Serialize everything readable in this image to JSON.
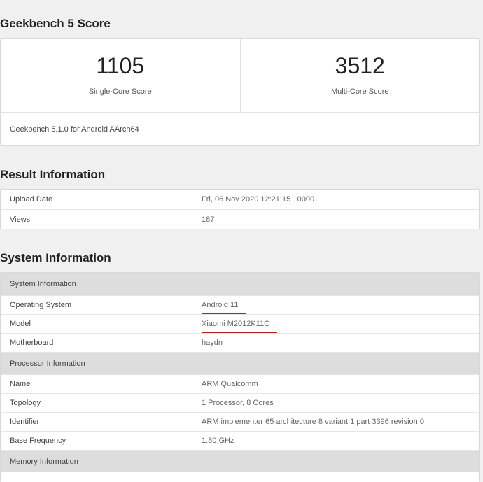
{
  "geekbench": {
    "title": "Geekbench 5 Score",
    "single_core_value": "1105",
    "single_core_label": "Single-Core Score",
    "multi_core_value": "3512",
    "multi_core_label": "Multi-Core Score",
    "version": "Geekbench 5.1.0 for Android AArch64"
  },
  "result": {
    "title": "Result Information",
    "rows": [
      {
        "key": "Upload Date",
        "value": "Fri, 06 Nov 2020 12:21:15 +0000"
      },
      {
        "key": "Views",
        "value": "187"
      }
    ]
  },
  "system": {
    "title": "System Information",
    "system_header": "System Information",
    "system_rows": [
      {
        "key": "Operating System",
        "value": "Android 11"
      },
      {
        "key": "Model",
        "value": "Xiaomi M2012K11C"
      },
      {
        "key": "Motherboard",
        "value": "haydn"
      }
    ],
    "processor_header": "Processor Information",
    "processor_rows": [
      {
        "key": "Name",
        "value": "ARM Qualcomm"
      },
      {
        "key": "Topology",
        "value": "1 Processor, 8 Cores"
      },
      {
        "key": "Identifier",
        "value": "ARM implementer 65 architecture 8 variant 1 part 3396 revision 0"
      },
      {
        "key": "Base Frequency",
        "value": "1.80 GHz"
      }
    ],
    "memory_header": "Memory Information"
  },
  "colors": {
    "underline": "#b3222c",
    "header_bg": "#dddddd",
    "page_bg": "#f0f0f0"
  }
}
